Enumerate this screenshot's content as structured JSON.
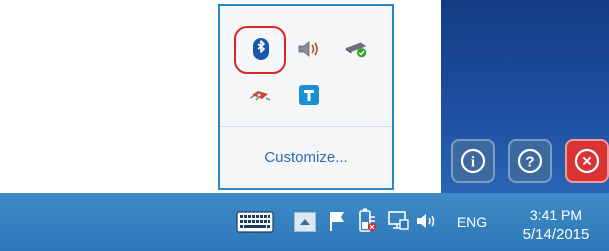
{
  "tray_popup": {
    "icons": [
      "bluetooth-icon",
      "volume-icon",
      "usb-device-icon",
      "network-adapter-icon",
      "app-t-icon"
    ],
    "customize_label": "Customize..."
  },
  "desktop_buttons": {
    "info_symbol": "i",
    "help_symbol": "?",
    "close_symbol": "×"
  },
  "taskbar": {
    "language": "ENG",
    "time": "3:41 PM",
    "date": "5/14/2015"
  },
  "colors": {
    "taskbar": "#2d78b7",
    "desktop": "#1d4e9f",
    "highlight_circle": "#e0252a",
    "link": "#2a6dbb",
    "close_button": "#d93333",
    "info_button": "#3c6a9f"
  }
}
